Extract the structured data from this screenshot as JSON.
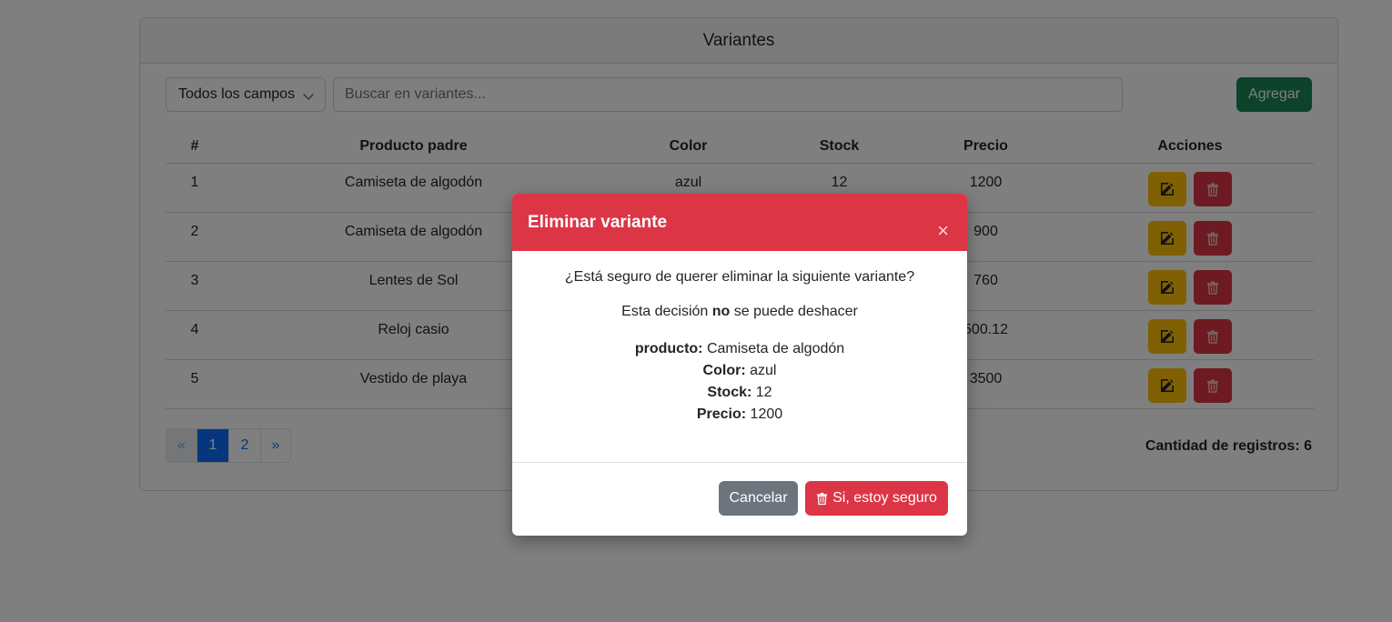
{
  "card": {
    "title": "Variantes",
    "filter_select": "Todos los campos",
    "search_placeholder": "Buscar en variantes...",
    "add_label": "Agregar"
  },
  "table": {
    "headers": [
      "#",
      "Producto padre",
      "Color",
      "Stock",
      "Precio",
      "Acciones"
    ],
    "rows": [
      {
        "num": "1",
        "producto": "Camiseta de algodón",
        "color": "azul",
        "stock": "12",
        "precio": "1200"
      },
      {
        "num": "2",
        "producto": "Camiseta de algodón",
        "color": "",
        "stock": "",
        "precio": "900"
      },
      {
        "num": "3",
        "producto": "Lentes de Sol",
        "color": "",
        "stock": "",
        "precio": "760"
      },
      {
        "num": "4",
        "producto": "Reloj casio",
        "color": "",
        "stock": "",
        "precio": "500.12"
      },
      {
        "num": "5",
        "producto": "Vestido de playa",
        "color": "",
        "stock": "",
        "precio": "3500"
      }
    ]
  },
  "pagination": {
    "prev": "«",
    "pages": [
      "1",
      "2"
    ],
    "active_page": "1",
    "next": "»"
  },
  "record_count": "Cantidad de registros: 6",
  "modal": {
    "title": "Eliminar variante",
    "close_icon": "×",
    "question": "¿Está seguro de querer eliminar la siguiente variante?",
    "warning_pre": "Esta decisión ",
    "warning_bold": "no",
    "warning_post": " se puede deshacer",
    "details": [
      {
        "label": "producto:",
        "value": " Camiseta de algodón"
      },
      {
        "label": "Color:",
        "value": " azul"
      },
      {
        "label": "Stock:",
        "value": " 12"
      },
      {
        "label": "Precio:",
        "value": " 1200"
      }
    ],
    "cancel_label": "Cancelar",
    "confirm_label": "Si, estoy seguro"
  },
  "colors": {
    "primary": "#0d6efd",
    "success": "#198754",
    "danger": "#dc3545",
    "warning": "#ffc107",
    "secondary": "#6c757d"
  },
  "icons": {
    "edit": "edit-icon",
    "delete": "trash-icon",
    "dropdown": "chevron-down-icon"
  }
}
